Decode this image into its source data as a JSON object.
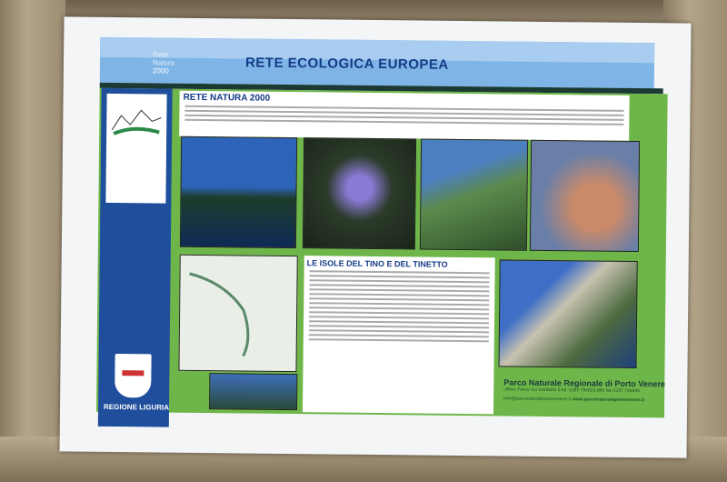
{
  "board": {
    "header": {
      "title": "RETE ECOLOGICA EUROPEA",
      "label_lines": [
        "Rete",
        "Natura",
        "2000"
      ]
    },
    "section1": {
      "title": "RETE NATURA 2000"
    },
    "section2": {
      "title": "LE ISOLE DEL TINO E DEL TINETTO"
    },
    "sidebar": {
      "region": "REGIONE LIGURIA"
    },
    "footer": {
      "park": "Parco Naturale Regionale di Porto Venere",
      "office": "Ufficio Parco Via Garibaldi 9 tel. 0187 794823-885 fax 0187 794846",
      "email": "info@parconaturaleportovenere.it",
      "web": "www.parconaturaleportovenere.it"
    }
  }
}
